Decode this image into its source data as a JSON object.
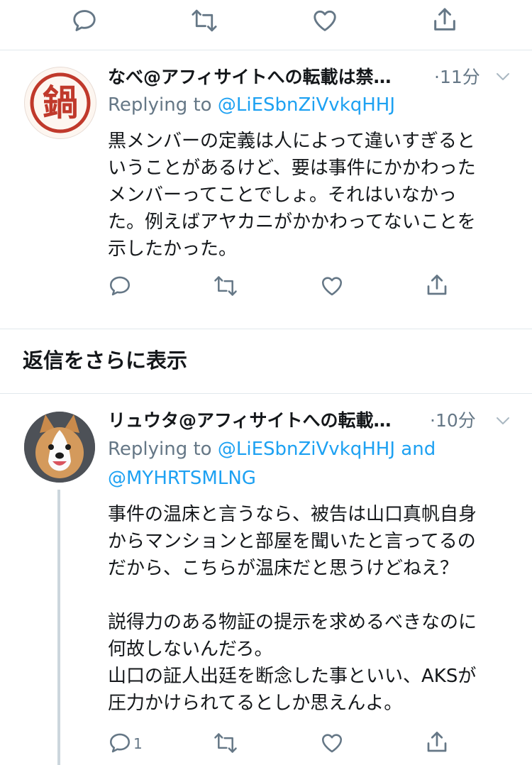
{
  "top_actions": {
    "icons": [
      "reply-icon",
      "retweet-icon",
      "like-icon",
      "share-icon"
    ]
  },
  "tweets": [
    {
      "name": "なべ@アフィサイトへの転載は禁…",
      "time": "·11分",
      "reply_prefix": "Replying to ",
      "reply_handles": "@LiESbnZiVvkqHHJ",
      "reply_handles_line2": "",
      "avatar_char": "鍋",
      "body": "黒メンバーの定義は人によって違いすぎると\nいうことがあるけど、要は事件にかかわった\nメンバーってことでしょ。それはいなかっ\nた。例えばアヤカニがかかわってないことを\n示したかった。",
      "reply_count": ""
    },
    {
      "name": "リュウタ@アフィサイトへの転載…",
      "time": "·10分",
      "reply_prefix": "Replying to ",
      "reply_handles": "@LiESbnZiVvkqHHJ and",
      "reply_handles_line2": "@MYHRTSMLNG",
      "avatar_char": "",
      "body": "事件の温床と言うなら、被告は山口真帆自身\nからマンションと部屋を聞いたと言ってるの\nだから、こちらが温床だと思うけどねえ？\n\n説得力のある物証の提示を求めるべきなのに\n何故しないんだろ。\n山口の証人出廷を断念した事といい、AKSが\n圧力かけられてるとしか思えんよ。",
      "reply_count": "1"
    }
  ],
  "show_more_label": "返信をさらに表示",
  "colors": {
    "text": "#14171a",
    "secondary": "#657786",
    "link": "#1da1f2",
    "divider": "#e1e8ed",
    "stamp_red": "#c0392b"
  }
}
